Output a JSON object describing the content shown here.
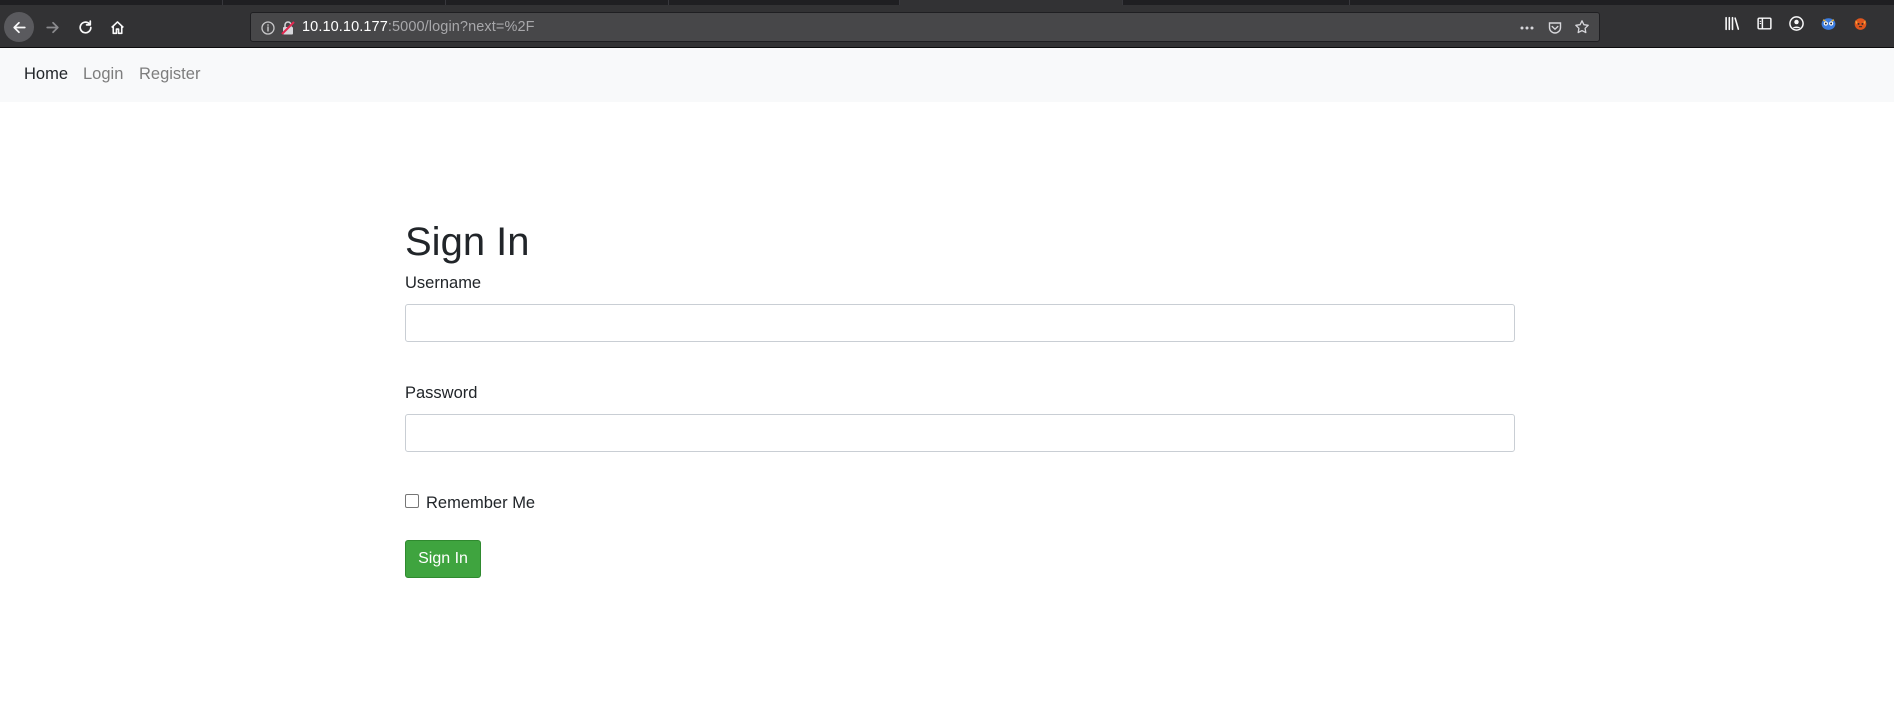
{
  "browser": {
    "url_host": "10.10.10.177",
    "url_rest": ":5000/login?next=%2F",
    "icons": [
      "back-arrow-icon",
      "forward-arrow-icon",
      "reload-icon",
      "home-icon",
      "info-icon",
      "insecure-lock-icon",
      "more-dots-icon",
      "pocket-icon",
      "star-icon",
      "library-icon",
      "sidebar-icon",
      "account-icon",
      "extension-icon",
      "firefox-extension-icon"
    ]
  },
  "nav": {
    "home": "Home",
    "login": "Login",
    "register": "Register"
  },
  "form": {
    "title": "Sign In",
    "username_label": "Username",
    "username_value": "",
    "password_label": "Password",
    "password_value": "",
    "remember_label": "Remember Me",
    "remember_checked": false,
    "submit_label": "Sign In"
  },
  "colors": {
    "submit_green": "#3fa43f",
    "navbar_bg": "#f8f9fa",
    "toolbar_bg": "#323234"
  }
}
